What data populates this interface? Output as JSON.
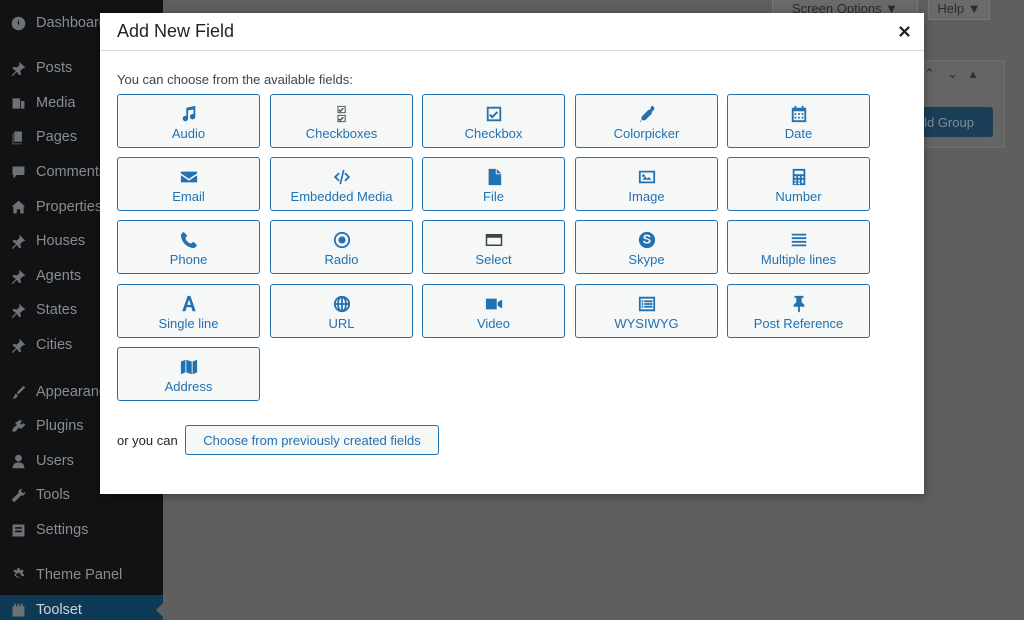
{
  "sidebar": {
    "items": [
      {
        "label": "Dashboard",
        "icon": "dashboard-icon"
      },
      {
        "label": "Posts",
        "icon": "pin-icon"
      },
      {
        "label": "Media",
        "icon": "media-icon"
      },
      {
        "label": "Pages",
        "icon": "pages-icon"
      },
      {
        "label": "Comments",
        "icon": "comment-icon"
      },
      {
        "label": "Properties",
        "icon": "home-icon"
      },
      {
        "label": "Houses",
        "icon": "pin-icon"
      },
      {
        "label": "Agents",
        "icon": "pin-icon"
      },
      {
        "label": "States",
        "icon": "pin-icon"
      },
      {
        "label": "Cities",
        "icon": "pin-icon"
      },
      {
        "label": "Appearance",
        "icon": "brush-icon"
      },
      {
        "label": "Plugins",
        "icon": "plugin-icon"
      },
      {
        "label": "Users",
        "icon": "user-icon"
      },
      {
        "label": "Tools",
        "icon": "wrench-icon"
      },
      {
        "label": "Settings",
        "icon": "settings-icon"
      },
      {
        "label": "Theme Panel",
        "icon": "gear-icon"
      },
      {
        "label": "Toolset",
        "icon": "toolset-icon"
      }
    ]
  },
  "header": {
    "screen_options": "Screen Options ▼",
    "help": "Help ▼",
    "add_group_partial": "ld Group"
  },
  "modal": {
    "title": "Add New Field",
    "intro": "You can choose from the available fields:",
    "fields": [
      {
        "label": "Audio",
        "icon": "music-note-icon"
      },
      {
        "label": "Checkboxes",
        "icon": "checkboxes-icon"
      },
      {
        "label": "Checkbox",
        "icon": "checkbox-icon"
      },
      {
        "label": "Colorpicker",
        "icon": "eyedropper-icon"
      },
      {
        "label": "Date",
        "icon": "calendar-icon"
      },
      {
        "label": "Email",
        "icon": "envelope-icon"
      },
      {
        "label": "Embedded Media",
        "icon": "code-icon"
      },
      {
        "label": "File",
        "icon": "file-icon"
      },
      {
        "label": "Image",
        "icon": "image-icon"
      },
      {
        "label": "Number",
        "icon": "calculator-icon"
      },
      {
        "label": "Phone",
        "icon": "phone-icon"
      },
      {
        "label": "Radio",
        "icon": "radio-icon"
      },
      {
        "label": "Select",
        "icon": "select-icon"
      },
      {
        "label": "Skype",
        "icon": "skype-icon"
      },
      {
        "label": "Multiple lines",
        "icon": "lines-icon"
      },
      {
        "label": "Single line",
        "icon": "letter-a-icon"
      },
      {
        "label": "URL",
        "icon": "globe-icon"
      },
      {
        "label": "Video",
        "icon": "video-camera-icon"
      },
      {
        "label": "WYSIWYG",
        "icon": "wysiwyg-icon"
      },
      {
        "label": "Post Reference",
        "icon": "thumbtack-icon"
      },
      {
        "label": "Address",
        "icon": "map-icon"
      }
    ],
    "or_text": "or you can",
    "previous_button": "Choose from previously created fields"
  },
  "colors": {
    "accent": "#2271b1",
    "sidebar_bg": "#101214",
    "overlay_bg": "#5f5f5f"
  }
}
